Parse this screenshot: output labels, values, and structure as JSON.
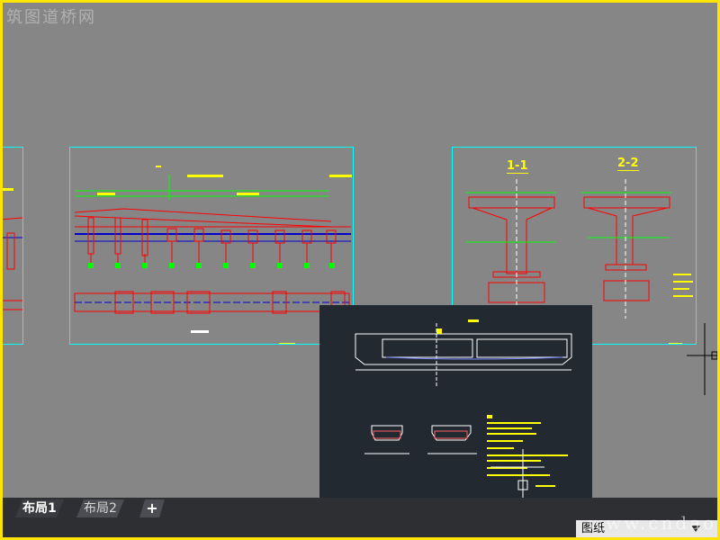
{
  "watermark_top": "筑图道桥网",
  "watermark_site": "www.cndao.com",
  "tabs": [
    {
      "label": "布局1",
      "active": true
    },
    {
      "label": "布局2",
      "active": false
    }
  ],
  "add_tab_label": "+",
  "status": {
    "paper": "图纸"
  },
  "sections": {
    "s1": "1-1",
    "s2": "2-2"
  },
  "colors": {
    "page_border": "#ffe400",
    "drawing_background": "#868686",
    "sheet_border": "#00ffff",
    "red_lines": "#ff0000",
    "green_lines": "#00ff00",
    "tab_bar": "#2e2f33",
    "popup_background": "#232931"
  },
  "icons": {
    "crosshair": "crosshair-icon",
    "dropdown": "chevron-down-icon"
  }
}
